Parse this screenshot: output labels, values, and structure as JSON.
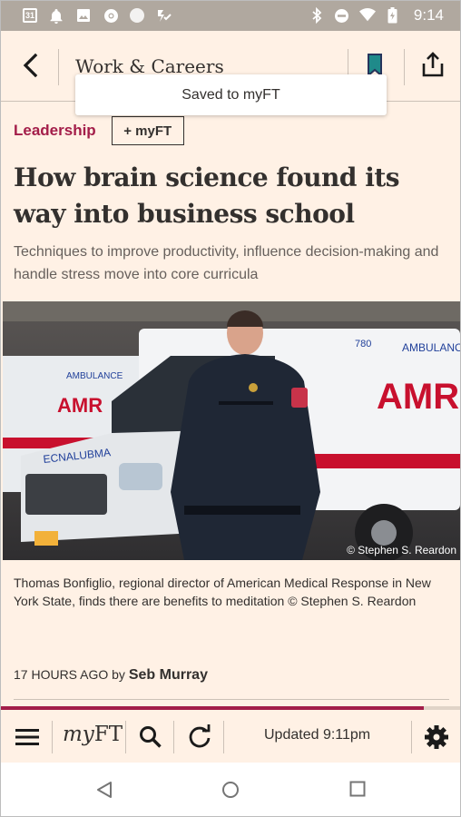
{
  "status_bar": {
    "calendar_day": "31",
    "time": "9:14"
  },
  "app_bar": {
    "section_title": "Work & Careers"
  },
  "toast": {
    "message": "Saved to myFT"
  },
  "article": {
    "tag": "Leadership",
    "myft_button_label": "+ myFT",
    "headline": "How brain science found its way into business school",
    "standfirst": "Techniques to improve productivity, influence decision-making and handle stress move into core curricula",
    "image_credit": "© Stephen S. Reardon",
    "caption": "Thomas Bonfiglio, regional director of American Medical Response in New York State, finds there are benefits to meditation © Stephen S. Reardon",
    "time_ago": "17 HOURS AGO by ",
    "author": "Seb Murray",
    "read_progress_percent": 92
  },
  "toolbar": {
    "myft_prefix": "my",
    "myft_suffix": "FT",
    "updated_text": "Updated 9:11pm"
  },
  "colors": {
    "background": "#fff1e5",
    "accent": "#a31d49",
    "bookmark": "#1f8a8a",
    "text": "#33302e"
  },
  "icons": [
    "calendar-icon",
    "bell-icon",
    "image-icon",
    "chrome-icon",
    "circle-icon",
    "check-icon",
    "bluetooth-icon",
    "dnd-icon",
    "wifi-icon",
    "battery-icon",
    "back-arrow-icon",
    "bookmark-icon",
    "share-icon",
    "menu-icon",
    "search-icon",
    "refresh-icon",
    "gear-icon",
    "nav-back-icon",
    "nav-home-icon",
    "nav-recent-icon"
  ]
}
